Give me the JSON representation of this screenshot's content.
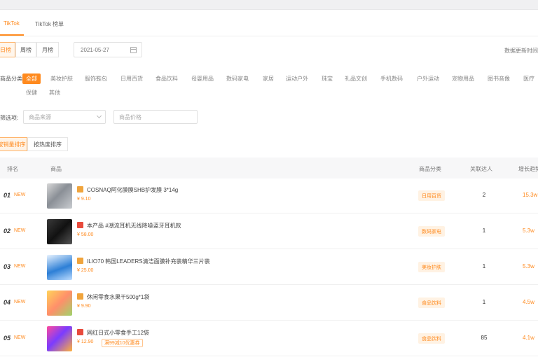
{
  "tabs": [
    "TikTok",
    "TikTok 榜单"
  ],
  "period_buttons": [
    "日榜",
    "周榜",
    "月榜"
  ],
  "date_value": "2021-05-27",
  "right_link": "数据更新时间",
  "category_label": "商品分类:",
  "categories_row1": [
    "全部",
    "美妆护肤",
    "服饰鞋包",
    "日用百货",
    "食品饮料",
    "母婴用品",
    "数码家电",
    "家居",
    "运动户外",
    "珠宝",
    "礼品文创",
    "手机数码",
    "户外运动",
    "宠物用品",
    "图书音像",
    "医疗"
  ],
  "categories_row2": [
    "保健",
    "其他"
  ],
  "filter_label": "筛选项:",
  "filter1_placeholder": "商品来源",
  "filter2_placeholder": "商品价格",
  "toggles": [
    "按销量排序",
    "按热度排序"
  ],
  "table_headers": [
    "排名",
    "商品",
    "商品分类",
    "关联达人",
    "增长趋势"
  ],
  "colors": {
    "accent": "#ff8a1e"
  },
  "rows": [
    {
      "rank": "01",
      "tag": "NEW",
      "thumb_icon": "box-product-image",
      "source_icon": "shop-icon",
      "source_color": "#f0a43c",
      "name": "COSNAQ阿化膜膜SHB护发膜 3*14g",
      "price": "¥ 9.10",
      "coupon": "",
      "category": "日用百货",
      "count": "2",
      "trend": "15.3w"
    },
    {
      "rank": "02",
      "tag": "NEW",
      "thumb_icon": "device-product-image",
      "source_icon": "video-icon",
      "source_color": "#e84a3c",
      "name": "本产品 #潮流耳机无线降噪蓝牙耳机款",
      "price": "¥ 58.00",
      "coupon": "",
      "category": "数码家电",
      "count": "1",
      "trend": "5.3w"
    },
    {
      "rank": "03",
      "tag": "NEW",
      "thumb_icon": "bottle-product-image",
      "source_icon": "shop-icon",
      "source_color": "#f0a43c",
      "name": "ILIO70 韩国LEADERS清洁面膜补充装精华三片装",
      "price": "¥ 25.00",
      "coupon": "",
      "category": "美妆护肤",
      "count": "1",
      "trend": "5.3w"
    },
    {
      "rank": "04",
      "tag": "NEW",
      "thumb_icon": "snack-product-image",
      "source_icon": "shop-icon",
      "source_color": "#f0a43c",
      "name": "休闲零食水果干500g*1袋",
      "price": "¥ 9.90",
      "coupon": "",
      "category": "食品饮料",
      "count": "1",
      "trend": "4.5w"
    },
    {
      "rank": "05",
      "tag": "NEW",
      "thumb_icon": "candy-product-image",
      "source_icon": "video-icon",
      "source_color": "#e84a3c",
      "name": "网红日式小零食手工12袋",
      "price": "¥ 12.90",
      "coupon": "满99减10优惠券",
      "category": "食品饮料",
      "count": "85",
      "trend": "4.1w"
    }
  ]
}
